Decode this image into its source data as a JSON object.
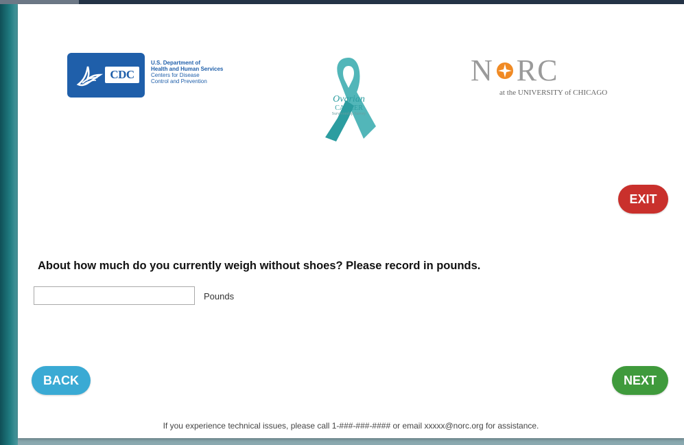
{
  "logos": {
    "cdc": {
      "badge_text": "CDC",
      "hhs_lines": [
        "U.S. Department of",
        "Health and Human Services",
        "Centers for Disease",
        "Control and Prevention"
      ]
    },
    "ribbon": {
      "line1": "Ovarian",
      "line2": "CANCER",
      "line3": "Survivorship Survey"
    },
    "norc": {
      "left": "N",
      "right": "RC",
      "subtitle": "at the UNIVERSITY of CHICAGO"
    }
  },
  "buttons": {
    "exit": "EXIT",
    "back": "BACK",
    "next": "NEXT"
  },
  "question": {
    "text": "About how much do you currently weigh without shoes? Please record in pounds.",
    "input_value": "",
    "unit_label": "Pounds"
  },
  "footer": {
    "text": "If you experience technical issues, please call 1-###-###-#### or email xxxxx@norc.org for assistance."
  },
  "colors": {
    "cdc_blue": "#1f5faa",
    "ribbon_teal": "#2c9da0",
    "norc_orange": "#f08a24",
    "exit_red": "#c9302c",
    "back_blue": "#3aaad4",
    "next_green": "#3f9a3c"
  }
}
